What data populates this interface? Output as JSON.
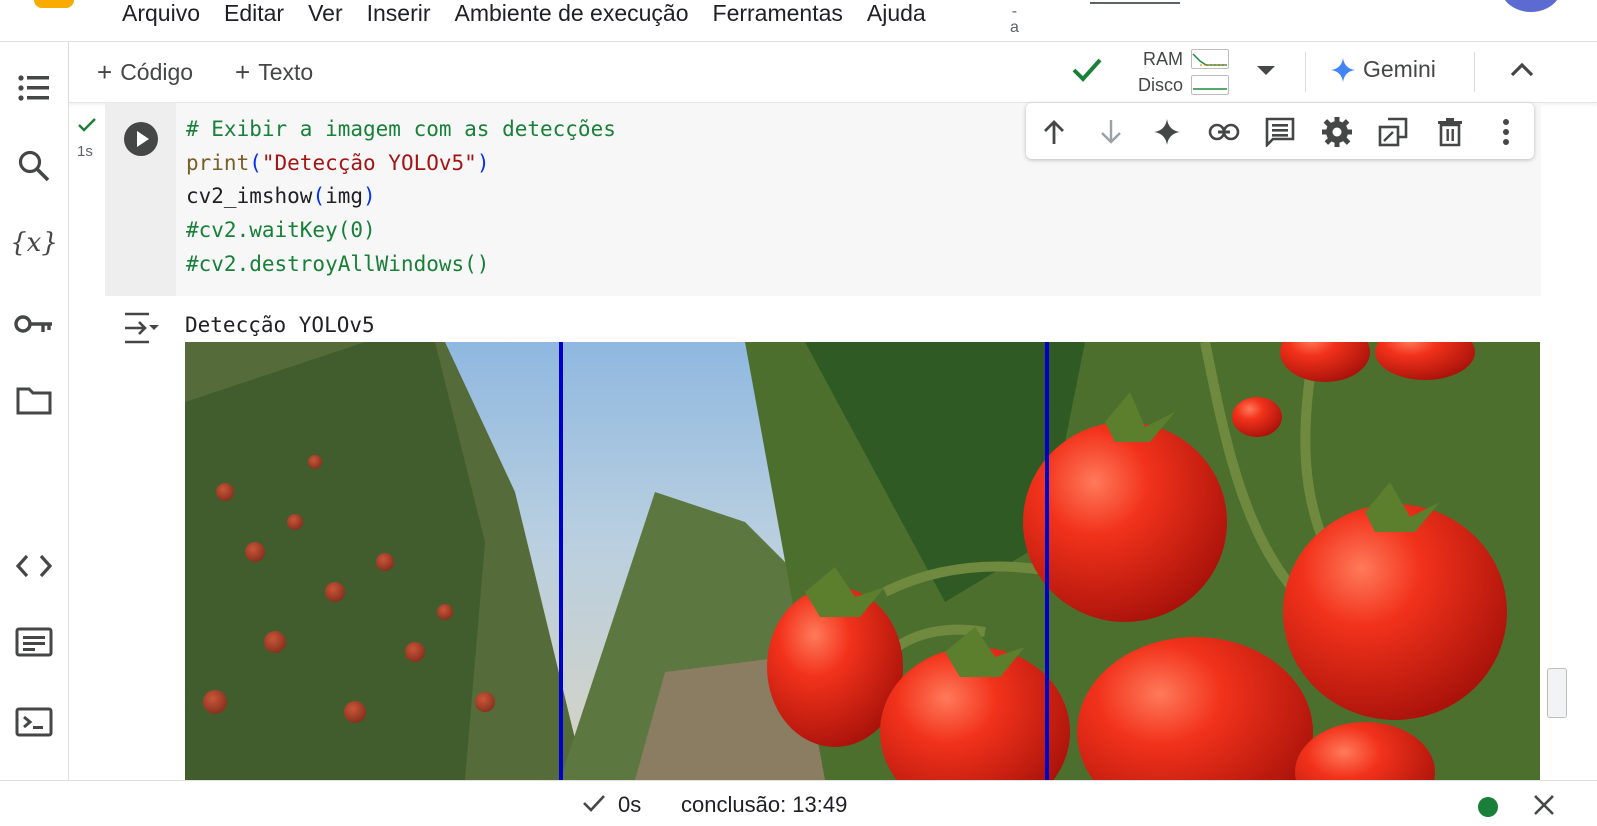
{
  "menubar": {
    "items": [
      "Arquivo",
      "Editar",
      "Ver",
      "Inserir",
      "Ambiente de execução",
      "Ferramentas",
      "Ajuda"
    ],
    "fragment": "-\na"
  },
  "rail": {
    "icons": [
      "table-of-contents-icon",
      "search-icon",
      "variables-icon",
      "secrets-key-icon",
      "folder-icon",
      "code-snippets-icon",
      "command-palette-icon",
      "terminal-icon"
    ]
  },
  "toolbar": {
    "add_code_label": "Código",
    "add_text_label": "Texto",
    "ram_label": "RAM",
    "disk_label": "Disco",
    "gemini_label": "Gemini"
  },
  "cell": {
    "exec_time": "1s",
    "code_lines": [
      {
        "type": "comment",
        "text": "# Exibir a imagem com as detecções"
      },
      {
        "type": "print",
        "fn": "print",
        "arg": "\"Detecção YOLOv5\""
      },
      {
        "type": "call",
        "fn": "cv2_imshow",
        "arg": "img"
      },
      {
        "type": "comment",
        "text": "#cv2.waitKey(0)"
      },
      {
        "type": "comment",
        "text": "#cv2.destroyAllWindows()"
      }
    ],
    "output_text": "Detecção YOLOv5"
  },
  "cell_toolbar": {
    "icons": [
      "move-up-icon",
      "move-down-icon",
      "gemini-sparkle-icon",
      "link-icon",
      "comment-icon",
      "settings-icon",
      "mirror-cell-icon",
      "delete-icon",
      "more-options-icon"
    ]
  },
  "statusbar": {
    "time": "0s",
    "completion": "conclusão: 13:49"
  },
  "colors": {
    "accent_blue": "#0b57d0",
    "success_green": "#188038",
    "detection_line": "#0000cc"
  }
}
